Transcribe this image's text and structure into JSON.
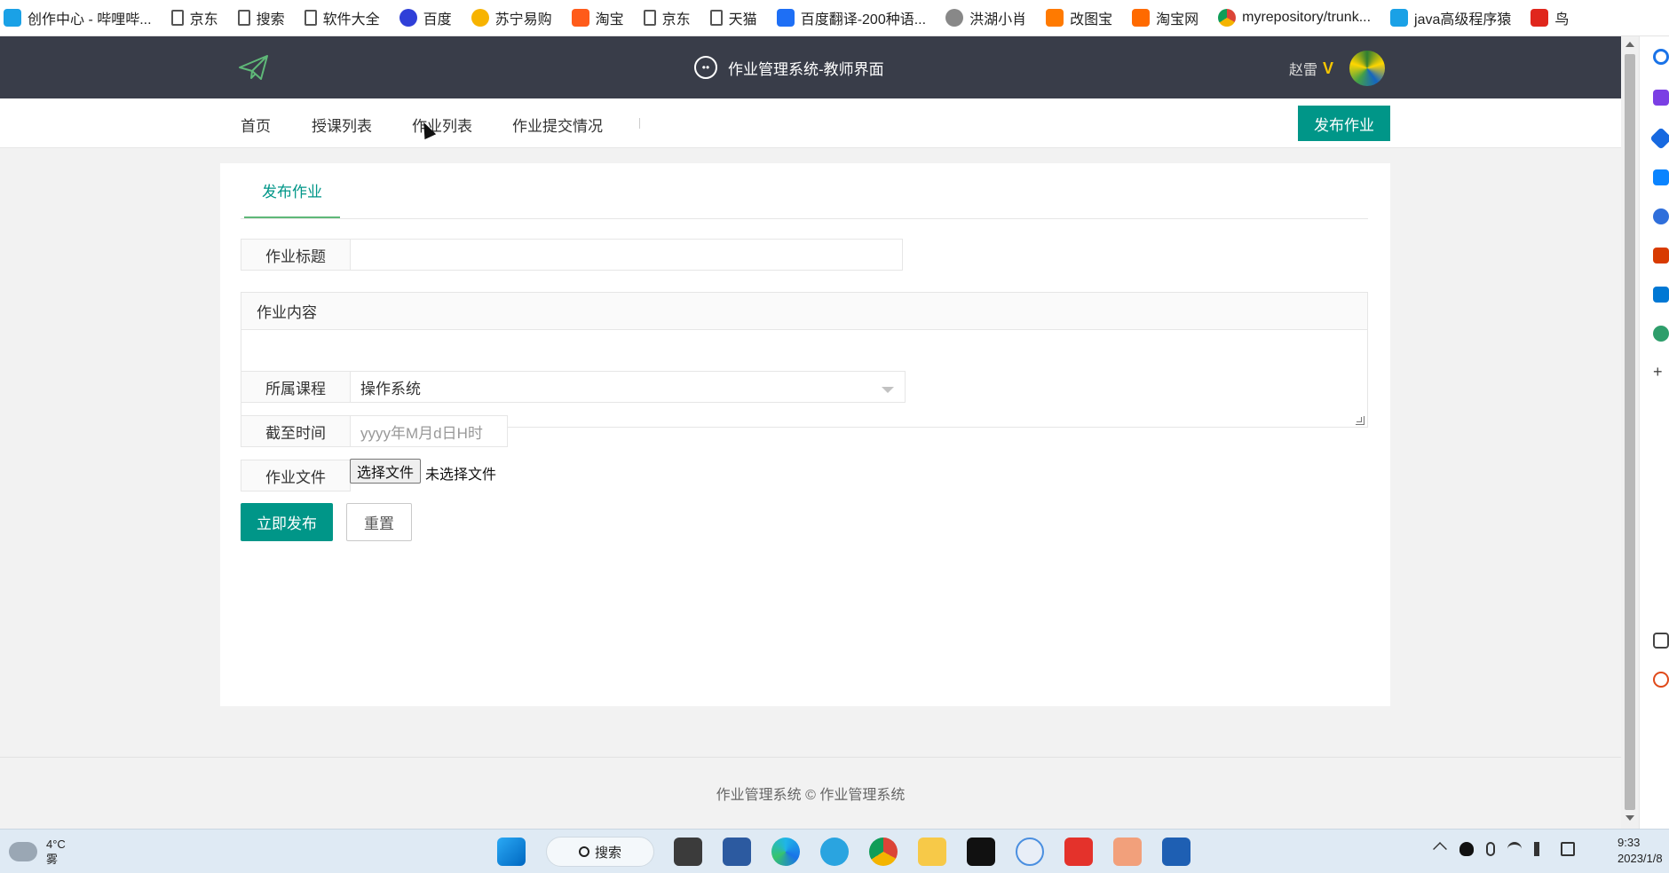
{
  "bookmarks": [
    {
      "label": "创作中心 - 哔哩哔...",
      "icon": "tv-icon"
    },
    {
      "label": "京东",
      "icon": "page-icon"
    },
    {
      "label": "搜索",
      "icon": "page-icon"
    },
    {
      "label": "软件大全",
      "icon": "page-icon"
    },
    {
      "label": "百度",
      "icon": "baidu-icon"
    },
    {
      "label": "苏宁易购",
      "icon": "suning-icon"
    },
    {
      "label": "淘宝",
      "icon": "taobao-icon"
    },
    {
      "label": "京东",
      "icon": "page-icon"
    },
    {
      "label": "天猫",
      "icon": "page-icon"
    },
    {
      "label": "百度翻译-200种语...",
      "icon": "translate-icon"
    },
    {
      "label": "洪湖小肖",
      "icon": "avatar-icon"
    },
    {
      "label": "改图宝",
      "icon": "image-icon"
    },
    {
      "label": "淘宝网",
      "icon": "taobao-icon"
    },
    {
      "label": "myrepository/trunk...",
      "icon": "chrome-icon"
    },
    {
      "label": "java高级程序猿",
      "icon": "tv-icon"
    },
    {
      "label": "鸟",
      "icon": "bird-icon"
    }
  ],
  "header": {
    "title": "作业管理系统-教师界面",
    "user_name": "赵雷",
    "vip_badge": "V"
  },
  "nav": {
    "items": [
      "首页",
      "授课列表",
      "作业列表",
      "作业提交情况"
    ],
    "publish_button": "发布作业"
  },
  "form": {
    "tab_label": "发布作业",
    "title_label": "作业标题",
    "title_value": "",
    "content_label": "作业内容",
    "content_value": "",
    "course_label": "所属课程",
    "course_value": "操作系统",
    "deadline_label": "截至时间",
    "deadline_placeholder": "yyyy年M月d日H时",
    "file_label": "作业文件",
    "file_button": "选择文件",
    "file_status": "未选择文件",
    "submit_button": "立即发布",
    "reset_button": "重置"
  },
  "footer": {
    "text": "作业管理系统 ©  作业管理系统"
  },
  "taskbar": {
    "temperature": "4°C",
    "weather": "雾",
    "search_label": "搜索",
    "time": "9:33",
    "date": "2023/1/8"
  },
  "colors": {
    "header_bg": "#393d49",
    "primary": "#009688",
    "tab_active": "#009688",
    "tab_underline": "#5fb878"
  }
}
